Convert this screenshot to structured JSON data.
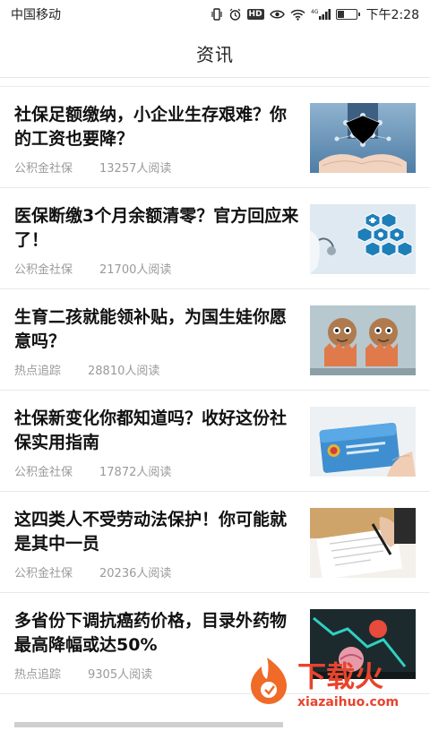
{
  "status": {
    "carrier": "中国移动",
    "time": "下午2:28",
    "battery_level": 0.45,
    "icons": [
      "vibrate-icon",
      "alarm-icon",
      "hd-icon",
      "eye-icon",
      "wifi-icon",
      "4g-signal-icon",
      "battery-icon"
    ]
  },
  "header": {
    "title": "资讯"
  },
  "articles": [
    {
      "title": "社保足额缴纳，小企业生存艰难？你的工资也要降？",
      "category": "公积金社保",
      "reads": "13257人阅读",
      "thumb": "hands-network-image"
    },
    {
      "title": "医保断缴3个月余额清零？官方回应来了！",
      "category": "公积金社保",
      "reads": "21700人阅读",
      "thumb": "medical-hexagon-image"
    },
    {
      "title": "生育二孩就能领补贴，为国生娃你愿意吗？",
      "category": "热点追踪",
      "reads": "28810人阅读",
      "thumb": "eggshell-babies-image"
    },
    {
      "title": "社保新变化你都知道吗？收好这份社保实用指南",
      "category": "公积金社保",
      "reads": "17872人阅读",
      "thumb": "social-security-card-image"
    },
    {
      "title": "这四类人不受劳动法保护！你可能就是其中一员",
      "category": "公积金社保",
      "reads": "20236人阅读",
      "thumb": "signing-document-image"
    },
    {
      "title": "多省份下调抗癌药价格，目录外药物最高降幅或达50%",
      "category": "热点追踪",
      "reads": "9305人阅读",
      "thumb": "falling-chart-image"
    }
  ],
  "watermark": {
    "text": "下载火",
    "url": "xiazaihuo.com"
  },
  "colors": {
    "accent": "#e8442c",
    "meta": "#9a9a9a",
    "title": "#111111"
  }
}
